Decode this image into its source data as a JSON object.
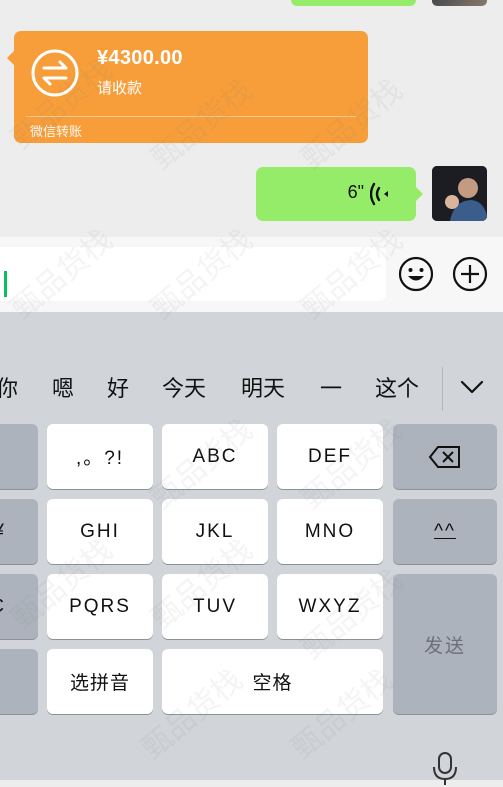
{
  "chat": {
    "transfer": {
      "amount": "¥4300.00",
      "status": "请收款",
      "source": "微信转账",
      "icon": "transfer-arrows-icon",
      "color": "#f79e3b"
    },
    "voice_message": {
      "duration": "6\"",
      "icon": "voice-wave-icon",
      "color": "#95ec69"
    }
  },
  "input_bar": {
    "emoji_icon": "emoji-icon",
    "add_icon": "plus-icon"
  },
  "keyboard": {
    "candidates": [
      "你",
      "嗯",
      "好",
      "今天",
      "明天",
      "一",
      "这个"
    ],
    "rows": [
      {
        "left": "",
        "keys": [
          ",。?!",
          "ABC",
          "DEF"
        ],
        "right": "⌫"
      },
      {
        "left": "¥",
        "keys": [
          "GHI",
          "JKL",
          "MNO"
        ],
        "right": "^^"
      },
      {
        "left": "C",
        "keys": [
          "PQRS",
          "TUV",
          "WXYZ"
        ],
        "right": "发送"
      },
      {
        "left": "",
        "keys": [
          "选拼音",
          "空格"
        ],
        "right": ""
      }
    ],
    "send_label": "发送",
    "space_label": "空格",
    "pinyin_label": "选拼音"
  },
  "watermark": "甄品货栈"
}
